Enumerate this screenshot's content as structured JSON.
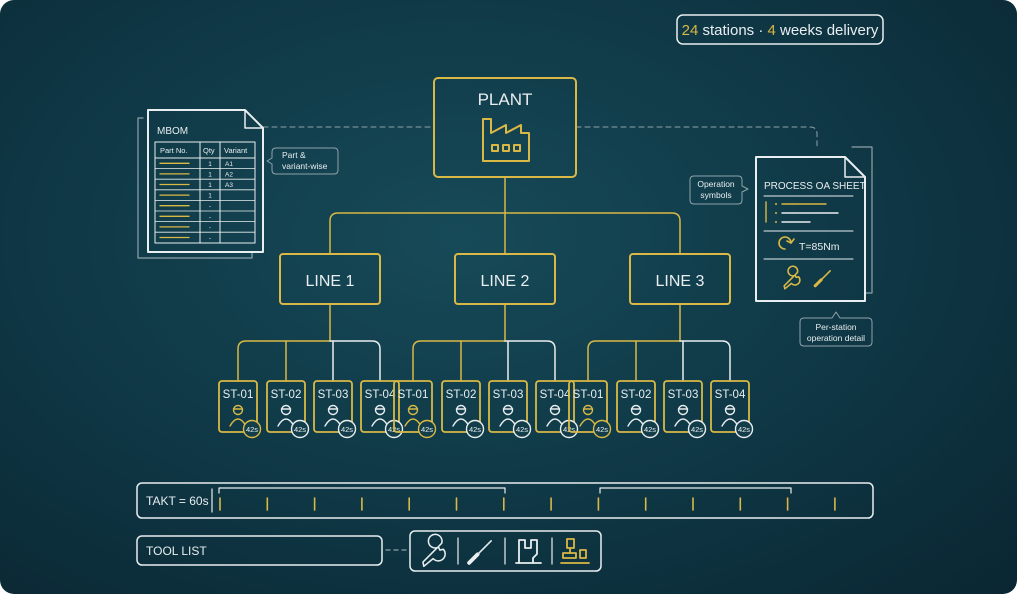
{
  "badge": {
    "stations_count": "24",
    "stations_text": " stations · ",
    "weeks_count": "4",
    "weeks_text": " weeks delivery"
  },
  "plant": {
    "label": "PLANT"
  },
  "mbom": {
    "title": "MBOM",
    "headers": [
      "Part No.",
      "Qty",
      "Variant"
    ],
    "rows": [
      {
        "qty": "1",
        "variant": "A1"
      },
      {
        "qty": "1",
        "variant": "A2"
      },
      {
        "qty": "1",
        "variant": "A3"
      },
      {
        "qty": "1",
        "variant": ""
      },
      {
        "qty": "-",
        "variant": ""
      },
      {
        "qty": "-",
        "variant": ""
      },
      {
        "qty": "-",
        "variant": ""
      },
      {
        "qty": "-",
        "variant": ""
      }
    ],
    "callout": [
      "Part &",
      "variant-wise"
    ]
  },
  "oa_sheet": {
    "title": "PROCESS OA SHEET",
    "torque": "T=85Nm",
    "callout_top": [
      "Operation",
      "symbols"
    ],
    "callout_bottom": [
      "Per-station",
      "operation detail"
    ]
  },
  "lines": [
    {
      "label": "LINE 1",
      "stations": [
        "ST-01",
        "ST-02",
        "ST-03",
        "ST-04"
      ]
    },
    {
      "label": "LINE 2",
      "stations": [
        "ST-01",
        "ST-02",
        "ST-03",
        "ST-04"
      ]
    },
    {
      "label": "LINE 3",
      "stations": [
        "ST-01",
        "ST-02",
        "ST-03",
        "ST-04"
      ]
    }
  ],
  "station_time": "42s",
  "takt": {
    "label": "TAKT = 60s"
  },
  "tool_list": {
    "label": "TOOL LIST",
    "tools": [
      "wrench-icon",
      "screwdriver-icon",
      "fixture-icon",
      "torque-station-icon"
    ]
  },
  "colors": {
    "gold": "#d9b845",
    "white": "#e9eef0",
    "muted": "#8fa3aa"
  }
}
